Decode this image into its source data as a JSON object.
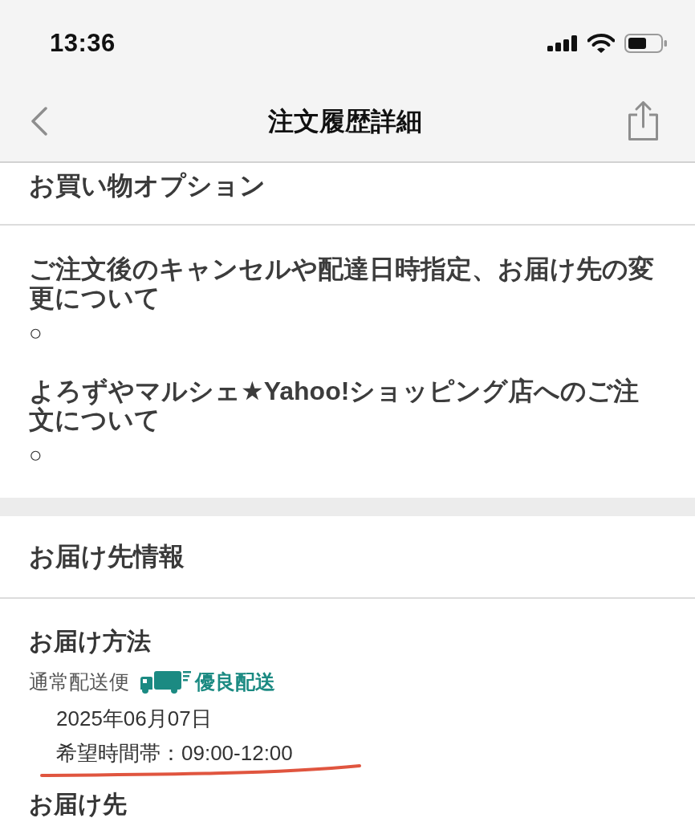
{
  "status_bar": {
    "time": "13:36"
  },
  "nav_bar": {
    "title": "注文履歴詳細"
  },
  "sections": [
    {
      "kind": "options",
      "title": "お買い物オプション",
      "items": [
        {
          "question": "ご注文後のキャンセルや配達日時指定、お届け先の変更について",
          "answer": "○"
        },
        {
          "question": "よろずやマルシェ★Yahoo!ショッピング店へのご注文について",
          "answer": "○"
        }
      ]
    },
    {
      "kind": "delivery",
      "title": "お届け先情報",
      "method": {
        "label": "お届け方法",
        "service": "通常配送便",
        "rating": "優良配送",
        "date": "2025年06月07日",
        "time_slot": "希望時間帯：09:00-12:00",
        "underlined": true
      },
      "address": {
        "label": "お届け先"
      }
    }
  ]
}
